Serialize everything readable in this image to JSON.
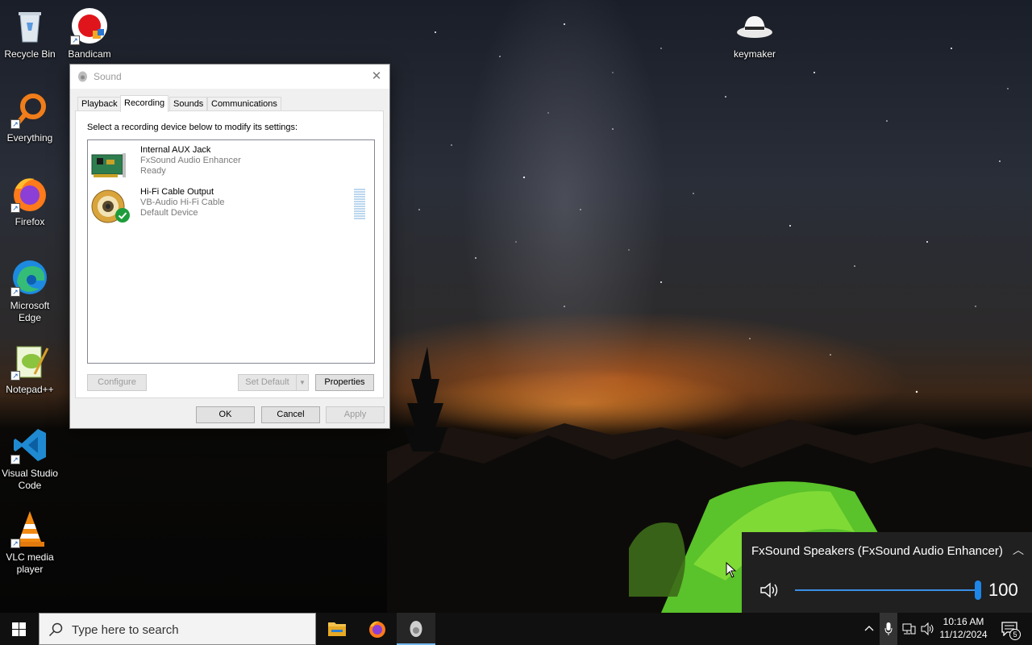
{
  "desktop": {
    "icons": [
      {
        "label": "Recycle Bin"
      },
      {
        "label": "Bandicam"
      },
      {
        "label": "keymaker"
      },
      {
        "label": "Everything"
      },
      {
        "label": "Firefox"
      },
      {
        "label": "Microsoft Edge"
      },
      {
        "label": "Notepad++"
      },
      {
        "label": "Visual Studio Code"
      },
      {
        "label": "VLC media player"
      }
    ]
  },
  "dialog": {
    "title": "Sound",
    "close_glyph": "✕",
    "tabs": [
      {
        "label": "Playback"
      },
      {
        "label": "Recording",
        "active": true
      },
      {
        "label": "Sounds"
      },
      {
        "label": "Communications"
      }
    ],
    "instruction": "Select a recording device below to modify its settings:",
    "devices": [
      {
        "name": "Internal AUX Jack",
        "driver": "FxSound Audio Enhancer",
        "status": "Ready"
      },
      {
        "name": "Hi-Fi Cable Output",
        "driver": "VB-Audio Hi-Fi Cable",
        "status": "Default Device"
      }
    ],
    "buttons": {
      "configure": "Configure",
      "set_default": "Set Default",
      "properties": "Properties",
      "ok": "OK",
      "cancel": "Cancel",
      "apply": "Apply"
    }
  },
  "volume_flyout": {
    "device_name": "FxSound Speakers (FxSound Audio Enhancer)",
    "volume": "100",
    "volume_level": 1.0
  },
  "taskbar": {
    "search_placeholder": "Type here to search",
    "apps": [
      "file-explorer",
      "firefox",
      "sound-settings"
    ],
    "clock_time": "10:16 AM",
    "clock_date": "11/12/2024",
    "notification_count": "5"
  }
}
